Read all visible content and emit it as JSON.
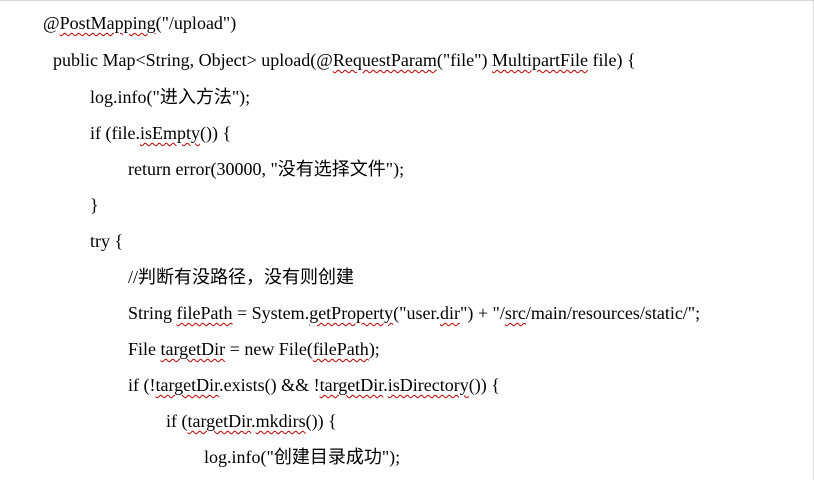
{
  "document": {
    "code_lines": [
      {
        "parts": [
          {
            "text": "@"
          },
          {
            "text": "PostMapping",
            "spell": true
          },
          {
            "text": "(\"/upload\")"
          }
        ]
      },
      {
        "parts": [
          {
            "text": "public Map<String, Object> upload(@"
          },
          {
            "text": "RequestParam",
            "spell": true
          },
          {
            "text": "(\"file\") "
          },
          {
            "text": "MultipartFile",
            "spell": true
          },
          {
            "text": " file) {"
          }
        ]
      },
      {
        "parts": [
          {
            "text": "log.info(\"进入方法\");"
          }
        ]
      },
      {
        "parts": [
          {
            "text": "if (file."
          },
          {
            "text": "isEmpty",
            "spell": true
          },
          {
            "text": "()) {"
          }
        ]
      },
      {
        "parts": [
          {
            "text": "return error(30000, \"没有选择文件\");"
          }
        ]
      },
      {
        "parts": [
          {
            "text": "}"
          }
        ]
      },
      {
        "parts": [
          {
            "text": "try {"
          }
        ]
      },
      {
        "parts": [
          {
            "text": "//判断有没路径，没有则创建"
          }
        ]
      },
      {
        "parts": [
          {
            "text": "String "
          },
          {
            "text": "filePath",
            "spell": true
          },
          {
            "text": " = System."
          },
          {
            "text": "getProperty",
            "spell": true
          },
          {
            "text": "(\"user."
          },
          {
            "text": "dir",
            "spell": true
          },
          {
            "text": "\") + \"/"
          },
          {
            "text": "src",
            "spell": true
          },
          {
            "text": "/main/resources/static/\";"
          }
        ]
      },
      {
        "parts": [
          {
            "text": "File "
          },
          {
            "text": "targetDir",
            "spell": true
          },
          {
            "text": " = new File("
          },
          {
            "text": "filePath",
            "spell": true
          },
          {
            "text": ");"
          }
        ]
      },
      {
        "parts": [
          {
            "text": "if (!"
          },
          {
            "text": "targetDir",
            "spell": true
          },
          {
            "text": ".exists() && !"
          },
          {
            "text": "targetDir",
            "spell": true
          },
          {
            "text": "."
          },
          {
            "text": "isDirectory",
            "spell": true
          },
          {
            "text": "()) {"
          }
        ]
      },
      {
        "parts": [
          {
            "text": "if ("
          },
          {
            "text": "targetDir",
            "spell": true
          },
          {
            "text": "."
          },
          {
            "text": "mkdirs",
            "spell": true
          },
          {
            "text": "()) {"
          }
        ]
      },
      {
        "parts": [
          {
            "text": "log.info(\"创建目录成功\");"
          }
        ]
      }
    ]
  }
}
